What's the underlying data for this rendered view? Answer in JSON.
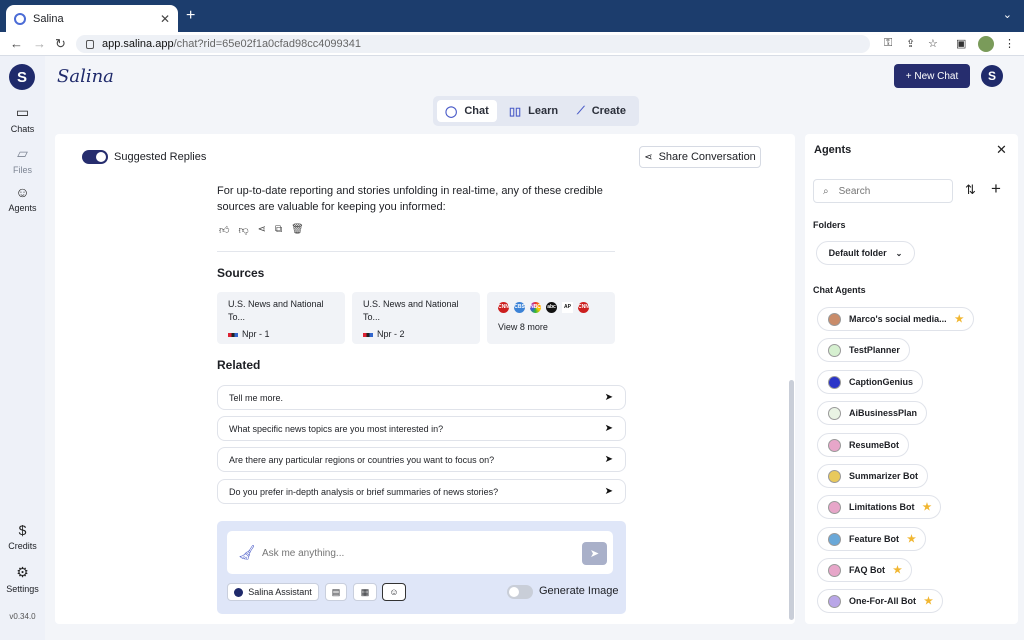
{
  "browser": {
    "tab_title": "Salina",
    "tab_close": "✕",
    "new_tab": "+",
    "url_host": "app.salina.app",
    "url_path": "/chat?rid=65e02f1a0cfad98cc4099341"
  },
  "sidebar": {
    "items": [
      {
        "label": "Chats",
        "icon": "chat-bubble-icon"
      },
      {
        "label": "Files",
        "icon": "folder-icon"
      },
      {
        "label": "Agents",
        "icon": "person-icon"
      },
      {
        "label": "Credits",
        "icon": "dollar-icon"
      },
      {
        "label": "Settings",
        "icon": "gear-icon"
      }
    ],
    "version": "v0.34.0"
  },
  "header": {
    "brand": "Salina",
    "new_chat_label": "+ New Chat",
    "modes": [
      {
        "label": "Chat",
        "active": true
      },
      {
        "label": "Learn",
        "active": false
      },
      {
        "label": "Create",
        "active": false
      }
    ]
  },
  "chat": {
    "suggested_replies_label": "Suggested Replies",
    "suggested_replies_on": true,
    "share_label": "Share Conversation",
    "message": "For up-to-date reporting and stories unfolding in real-time, any of these credible sources are valuable for keeping you informed:",
    "sources_heading": "Sources",
    "sources": [
      {
        "title": "U.S. News and National To...",
        "meta": "Npr - 1"
      },
      {
        "title": "U.S. News and National To...",
        "meta": "Npr - 2"
      }
    ],
    "more_sources_logos": [
      "CNN",
      "CBS",
      "NBC",
      "abc",
      "AP",
      "CNN"
    ],
    "more_sources_label": "View 8 more",
    "related_heading": "Related",
    "related": [
      "Tell me more.",
      "What specific news topics are you most interested in?",
      "Are there any particular regions or countries you want to focus on?",
      "Do you prefer in-depth analysis or brief summaries of news stories?"
    ],
    "input_placeholder": "Ask me anything...",
    "assistant_label": "Salina Assistant",
    "generate_image_label": "Generate Image",
    "generate_image_on": false
  },
  "agents_panel": {
    "title": "Agents",
    "search_placeholder": "Search",
    "folders_heading": "Folders",
    "folder_selected": "Default folder",
    "chat_agents_heading": "Chat Agents",
    "agents": [
      {
        "name": "Marco's social media...",
        "starred": true,
        "color": "#c98c6a"
      },
      {
        "name": "TestPlanner",
        "starred": false,
        "color": "#d6f0d0"
      },
      {
        "name": "CaptionGenius",
        "starred": false,
        "color": "#2b35c8"
      },
      {
        "name": "AiBusinessPlan",
        "starred": false,
        "color": "#e9f3e4"
      },
      {
        "name": "ResumeBot",
        "starred": false,
        "color": "#e7a6c9"
      },
      {
        "name": "Summarizer Bot",
        "starred": false,
        "color": "#e8c95c"
      },
      {
        "name": "Limitations Bot",
        "starred": true,
        "color": "#e7a6c9"
      },
      {
        "name": "Feature Bot",
        "starred": true,
        "color": "#6aa8d8"
      },
      {
        "name": "FAQ Bot",
        "starred": true,
        "color": "#e7a6c9"
      },
      {
        "name": "One-For-All Bot",
        "starred": true,
        "color": "#b9a6e7"
      }
    ]
  }
}
